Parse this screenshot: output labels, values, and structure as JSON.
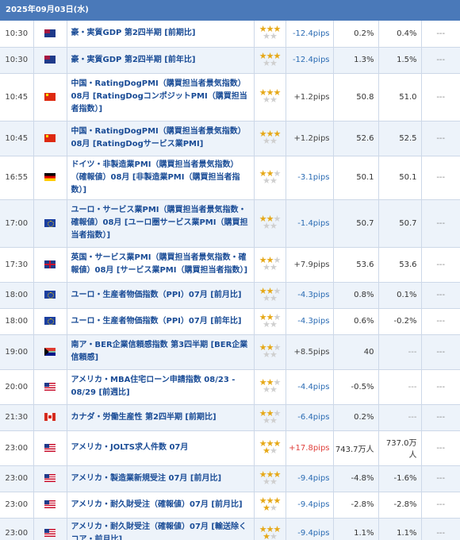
{
  "header": {
    "date": "2025年09月03日(水)"
  },
  "icons": {
    "au": "australia-flag-icon",
    "cn": "china-flag-icon",
    "de": "germany-flag-icon",
    "eu": "eu-flag-icon",
    "gb": "uk-flag-icon",
    "za": "south-africa-flag-icon",
    "us": "usa-flag-icon",
    "ca": "canada-flag-icon"
  },
  "colors": {
    "header_bg": "#4a79b9",
    "name": "#1a4c96",
    "pips_neg": "#2a6bb3",
    "pips_hot": "#e0413d",
    "star_on": "#e6a817"
  },
  "rows": [
    {
      "time": "10:30",
      "flag": "au",
      "name": "豪・実質GDP 第2四半期 [前期比]",
      "stars": 3,
      "pips": "-12.4pips",
      "pips_type": "neg",
      "result": "0.2%",
      "forecast": "0.4%",
      "prev": "---"
    },
    {
      "time": "10:30",
      "flag": "au",
      "name": "豪・実質GDP 第2四半期 [前年比]",
      "stars": 3,
      "pips": "-12.4pips",
      "pips_type": "neg",
      "result": "1.3%",
      "forecast": "1.5%",
      "prev": "---"
    },
    {
      "time": "10:45",
      "flag": "cn",
      "name": "中国・RatingDogPMI（購買担当者景気指数）08月 [RatingDogコンポジットPMI（購買担当者指数）]",
      "stars": 3,
      "pips": "+1.2pips",
      "pips_type": "pos",
      "result": "50.8",
      "forecast": "51.0",
      "prev": "---"
    },
    {
      "time": "10:45",
      "flag": "cn",
      "name": "中国・RatingDogPMI（購買担当者景気指数）08月 [RatingDogサービス業PMI]",
      "stars": 3,
      "pips": "+1.2pips",
      "pips_type": "pos",
      "result": "52.6",
      "forecast": "52.5",
      "prev": "---"
    },
    {
      "time": "16:55",
      "flag": "de",
      "name": "ドイツ・非製造業PMI（購買担当者景気指数）（確報値）08月 [非製造業PMI（購買担当者指数）]",
      "stars": 2,
      "pips": "-3.1pips",
      "pips_type": "neg",
      "result": "50.1",
      "forecast": "50.1",
      "prev": "---"
    },
    {
      "time": "17:00",
      "flag": "eu",
      "name": "ユーロ・サービス業PMI（購買担当者景気指数・確報値）08月 [ユーロ圏サービス業PMI（購買担当者指数）]",
      "stars": 2,
      "pips": "-1.4pips",
      "pips_type": "neg",
      "result": "50.7",
      "forecast": "50.7",
      "prev": "---"
    },
    {
      "time": "17:30",
      "flag": "gb",
      "name": "英国・サービス業PMI（購買担当者景気指数・確報値）08月 [サービス業PMI（購買担当者指数）]",
      "stars": 2,
      "pips": "+7.9pips",
      "pips_type": "pos",
      "result": "53.6",
      "forecast": "53.6",
      "prev": "---"
    },
    {
      "time": "18:00",
      "flag": "eu",
      "name": "ユーロ・生産者物価指数（PPI）07月 [前月比]",
      "stars": 2,
      "pips": "-4.3pips",
      "pips_type": "neg",
      "result": "0.8%",
      "forecast": "0.1%",
      "prev": "---"
    },
    {
      "time": "18:00",
      "flag": "eu",
      "name": "ユーロ・生産者物価指数（PPI）07月 [前年比]",
      "stars": 2,
      "pips": "-4.3pips",
      "pips_type": "neg",
      "result": "0.6%",
      "forecast": "-0.2%",
      "prev": "---"
    },
    {
      "time": "19:00",
      "flag": "za",
      "name": "南ア・BER企業信頼感指数 第3四半期 [BER企業信頼感]",
      "stars": 2,
      "pips": "+8.5pips",
      "pips_type": "pos",
      "result": "40",
      "forecast": "---",
      "prev": "---"
    },
    {
      "time": "20:00",
      "flag": "us",
      "name": "アメリカ・MBA住宅ローン申請指数 08/23 - 08/29 [前週比]",
      "stars": 2,
      "pips": "-4.4pips",
      "pips_type": "neg",
      "result": "-0.5%",
      "forecast": "---",
      "prev": "---"
    },
    {
      "time": "21:30",
      "flag": "ca",
      "name": "カナダ・労働生産性 第2四半期 [前期比]",
      "stars": 2,
      "pips": "-6.4pips",
      "pips_type": "neg",
      "result": "0.2%",
      "forecast": "---",
      "prev": "---"
    },
    {
      "time": "23:00",
      "flag": "us",
      "name": "アメリカ・JOLTS求人件数 07月",
      "stars": 4,
      "pips": "+17.8pips",
      "pips_type": "hot",
      "result": "743.7万人",
      "forecast": "737.0万人",
      "prev": "---"
    },
    {
      "time": "23:00",
      "flag": "us",
      "name": "アメリカ・製造業新規受注 07月 [前月比]",
      "stars": 3,
      "pips": "-9.4pips",
      "pips_type": "neg",
      "result": "-4.8%",
      "forecast": "-1.6%",
      "prev": "---"
    },
    {
      "time": "23:00",
      "flag": "us",
      "name": "アメリカ・耐久財受注（確報値）07月 [前月比]",
      "stars": 4,
      "pips": "-9.4pips",
      "pips_type": "neg",
      "result": "-2.8%",
      "forecast": "-2.8%",
      "prev": "---"
    },
    {
      "time": "23:00",
      "flag": "us",
      "name": "アメリカ・耐久財受注（確報値）07月 [輸送除くコア・前月比]",
      "stars": 4,
      "pips": "-9.4pips",
      "pips_type": "neg",
      "result": "1.1%",
      "forecast": "1.1%",
      "prev": "---"
    }
  ]
}
